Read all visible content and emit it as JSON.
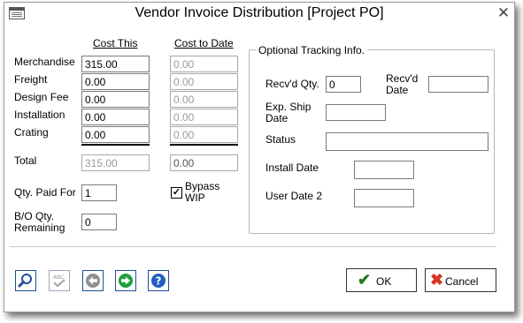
{
  "window": {
    "title": "Vendor Invoice Distribution [Project PO]"
  },
  "columns": {
    "cost_this": "Cost This",
    "cost_to_date": "Cost to Date"
  },
  "rows": [
    {
      "label": "Merchandise",
      "cost_this": "315.00",
      "cost_to_date": "0.00"
    },
    {
      "label": "Freight",
      "cost_this": "0.00",
      "cost_to_date": "0.00"
    },
    {
      "label": "Design Fee",
      "cost_this": "0.00",
      "cost_to_date": "0.00"
    },
    {
      "label": "Installation",
      "cost_this": "0.00",
      "cost_to_date": "0.00"
    },
    {
      "label": "Crating",
      "cost_this": "0.00",
      "cost_to_date": "0.00"
    }
  ],
  "total": {
    "label": "Total",
    "cost_this": "315.00",
    "cost_to_date": "0.00"
  },
  "qty_paid": {
    "label": "Qty. Paid For",
    "value": "1"
  },
  "bypass_wip": {
    "label_line1": "Bypass",
    "label_line2": "WIP",
    "checked": true,
    "mark": "✓"
  },
  "bo_qty": {
    "label_line1": "B/O Qty.",
    "label_line2": "Remaining",
    "value": "0"
  },
  "tracking": {
    "legend": "Optional Tracking Info.",
    "recvd_qty": {
      "label": "Recv'd Qty.",
      "value": "0"
    },
    "recvd_date": {
      "label_line1": "Recv'd",
      "label_line2": "Date",
      "value": ""
    },
    "exp_ship_date": {
      "label_line1": "Exp. Ship",
      "label_line2": "Date",
      "value": ""
    },
    "status": {
      "label": "Status",
      "value": ""
    },
    "install_date": {
      "label": "Install Date",
      "value": ""
    },
    "user_date_2": {
      "label": "User Date 2",
      "value": ""
    }
  },
  "toolbar": {
    "icons": [
      "magnifier-icon",
      "spellcheck-icon",
      "back-arrow-icon",
      "forward-arrow-icon",
      "help-icon"
    ]
  },
  "buttons": {
    "ok": {
      "label": "OK",
      "icon": "checkmark-icon",
      "color": "#1f7a1f"
    },
    "cancel": {
      "label": "Cancel",
      "icon": "red-x-icon",
      "color": "#d9341f"
    }
  },
  "colors": {
    "accent_blue": "#1f4e9e",
    "disabled_text": "#9a9a9a"
  }
}
